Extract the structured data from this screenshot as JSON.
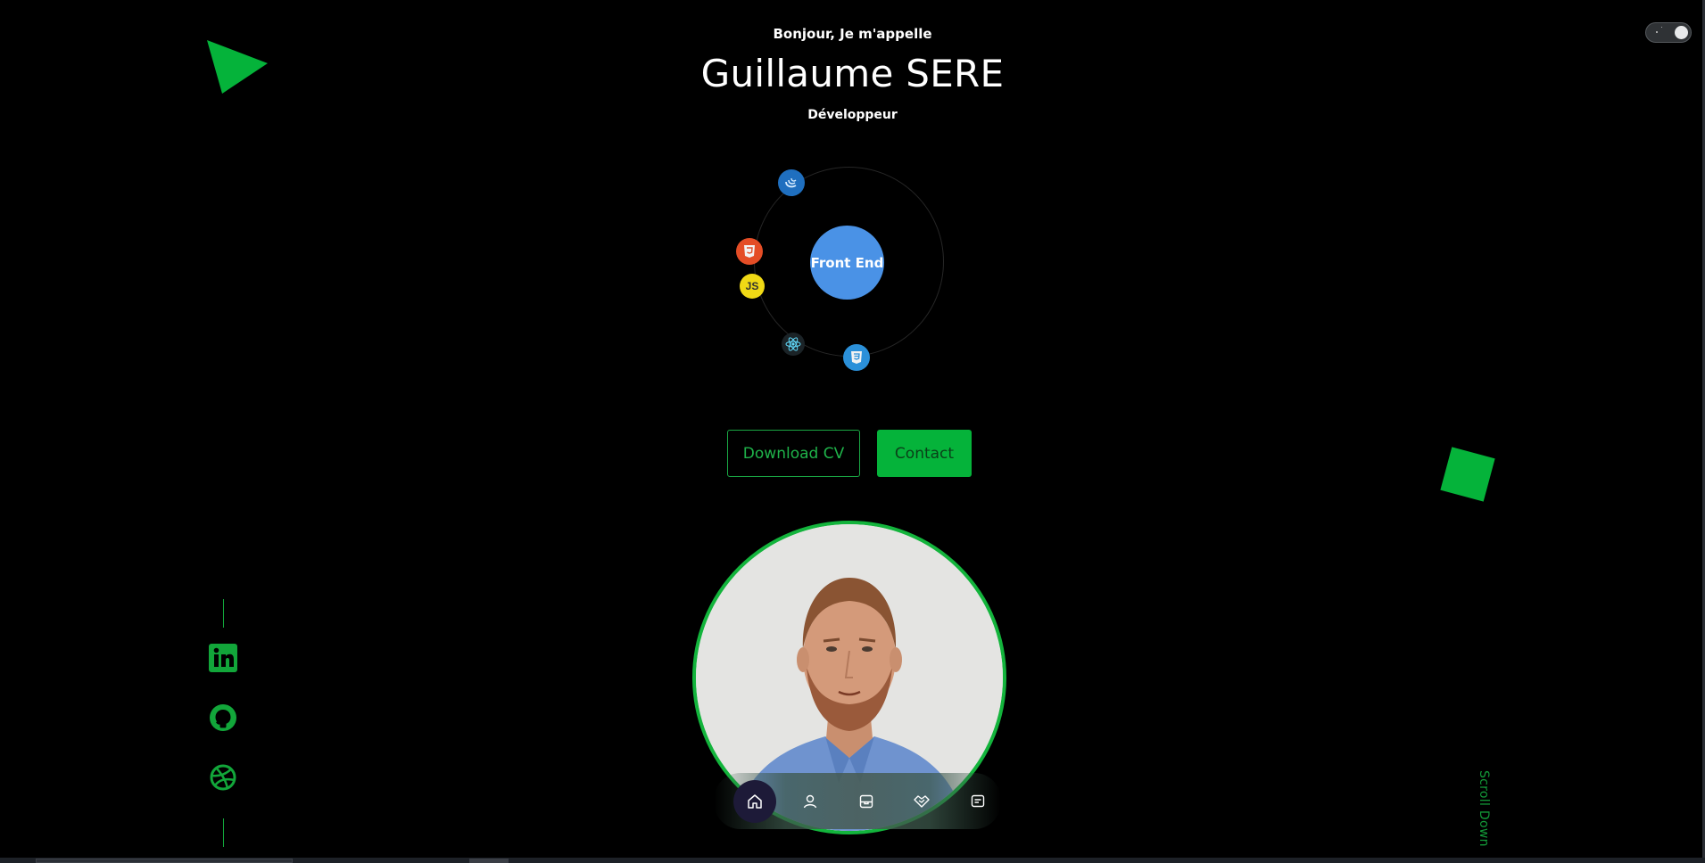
{
  "hero": {
    "greeting": "Bonjour, Je m'appelle",
    "name": "Guillaume SERE",
    "role": "Développeur"
  },
  "orbit": {
    "center_label": "Front End",
    "technologies": [
      "jquery-icon",
      "html5-icon",
      "javascript-icon",
      "react-icon",
      "css3-icon"
    ],
    "js_badge": "JS"
  },
  "actions": {
    "download_label": "Download CV",
    "contact_label": "Contact"
  },
  "socials": [
    "linkedin-icon",
    "github-icon",
    "dribbble-icon"
  ],
  "scroll_label": "Scroll Down",
  "nav": [
    "home-icon",
    "user-icon",
    "briefcase-icon",
    "handshake-icon",
    "message-icon"
  ],
  "colors": {
    "accent": "#05b33a",
    "background": "#000000",
    "core": "#4a92e6"
  }
}
